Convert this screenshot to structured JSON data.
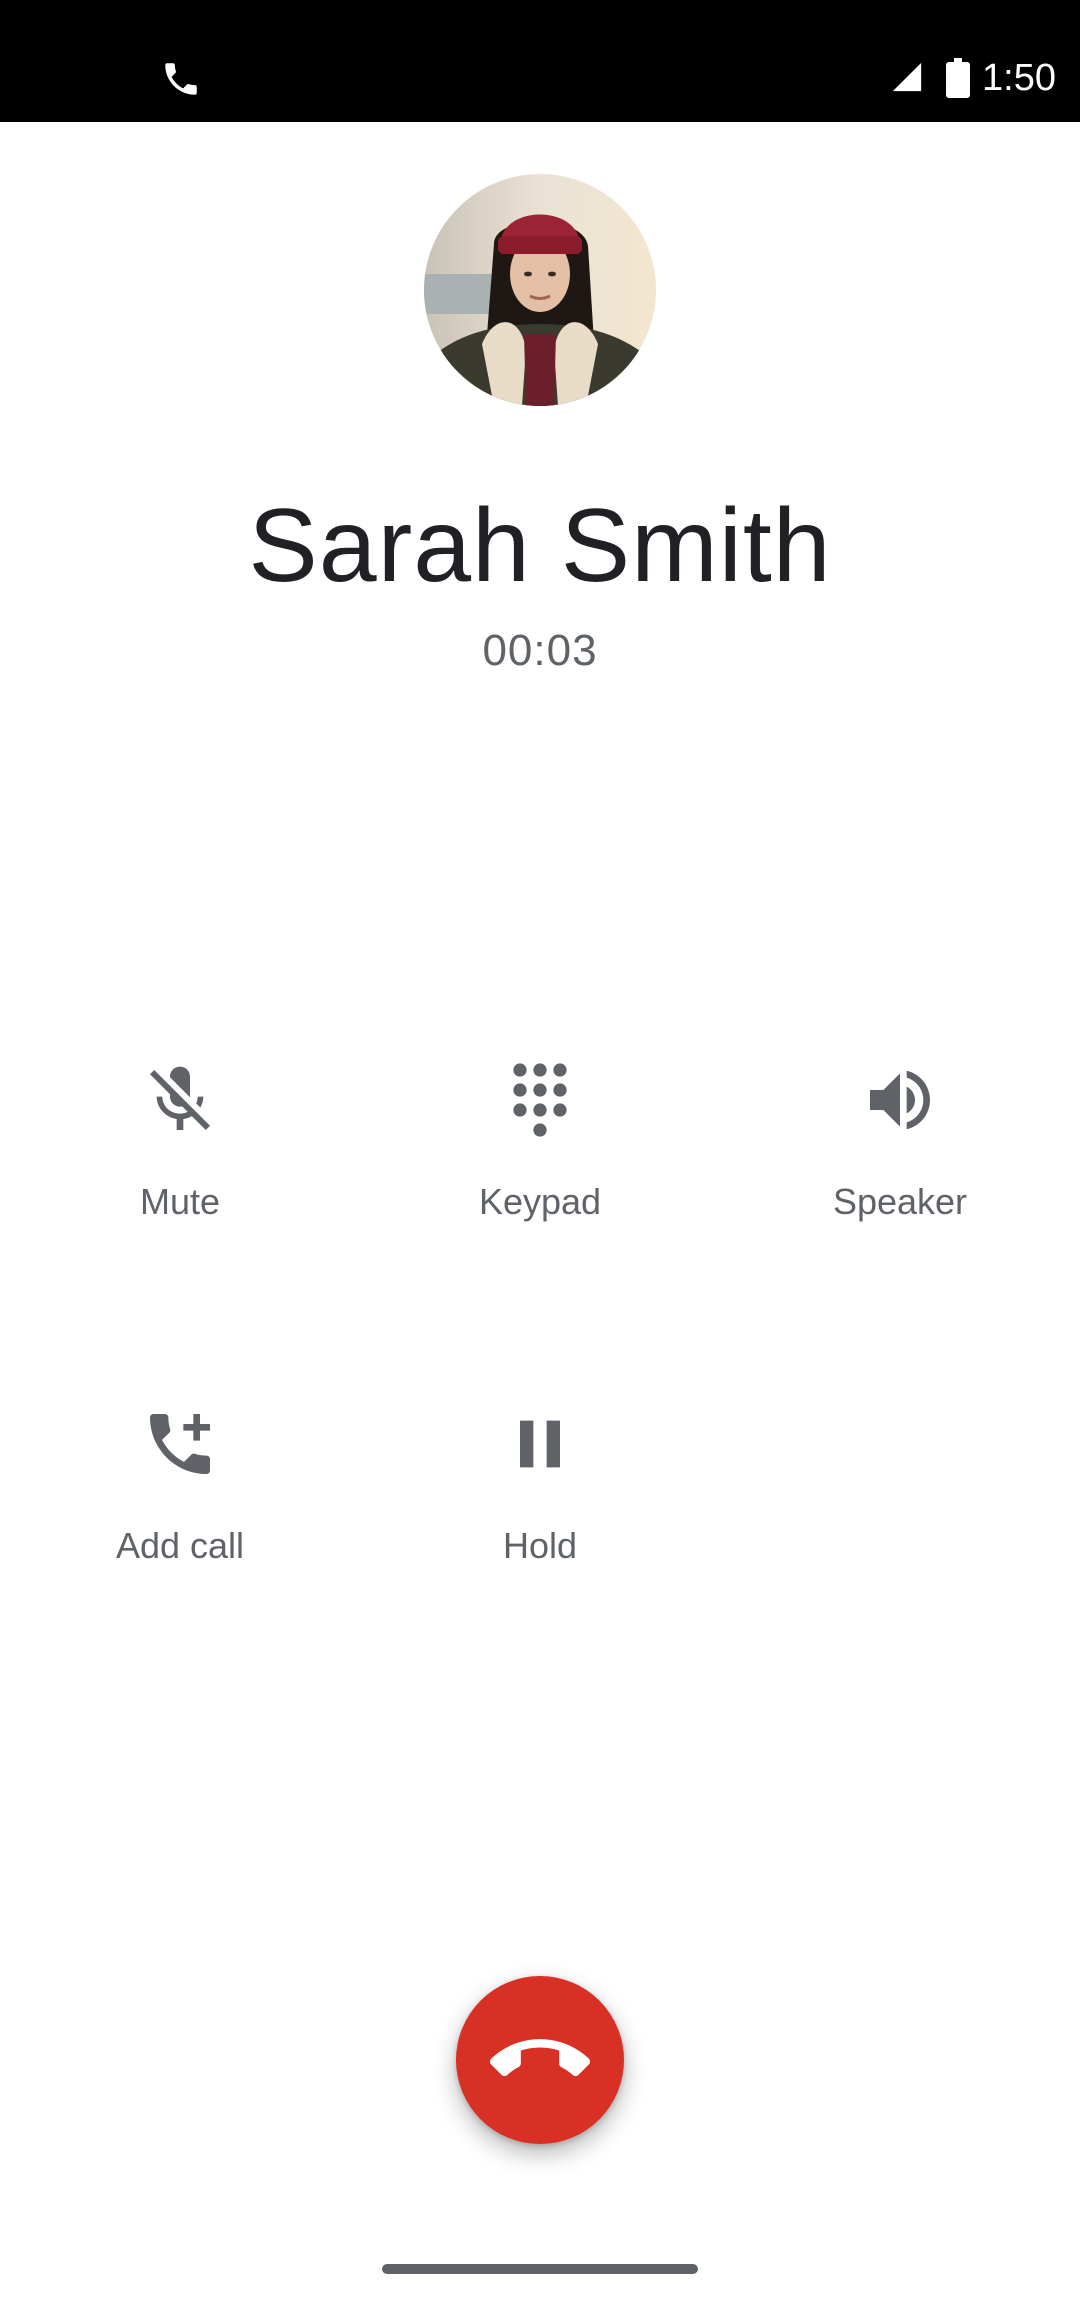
{
  "status_bar": {
    "time": "1:50",
    "icons": [
      "phone-call-indicator-icon",
      "cell-signal-icon",
      "battery-icon"
    ]
  },
  "contact": {
    "name": "Sarah Smith",
    "call_duration": "00:03",
    "avatar": "contact-photo"
  },
  "controls": {
    "mute": {
      "label": "Mute",
      "icon": "mic-off-icon"
    },
    "keypad": {
      "label": "Keypad",
      "icon": "dialpad-icon"
    },
    "speaker": {
      "label": "Speaker",
      "icon": "volume-up-icon"
    },
    "add_call": {
      "label": "Add call",
      "icon": "add-call-icon"
    },
    "hold": {
      "label": "Hold",
      "icon": "pause-icon"
    }
  },
  "end_call": {
    "icon": "call-end-icon"
  },
  "colors": {
    "end_call": "#d93025",
    "icon": "#5f6368",
    "text_primary": "#202124",
    "text_secondary": "#5f6368",
    "status_bar": "#000000"
  }
}
